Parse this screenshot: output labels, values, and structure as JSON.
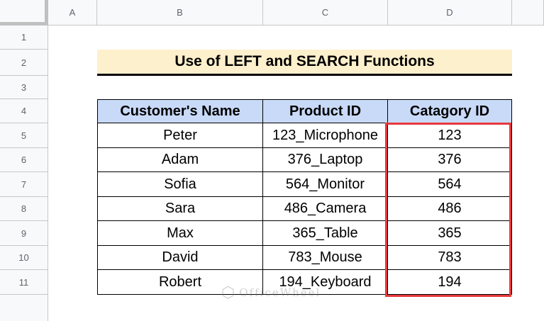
{
  "columns": [
    "A",
    "B",
    "C",
    "D"
  ],
  "rows": [
    "1",
    "2",
    "3",
    "4",
    "5",
    "6",
    "7",
    "8",
    "9",
    "10",
    "11"
  ],
  "title": "Use of LEFT and SEARCH Functions",
  "table": {
    "headers": [
      "Customer's Name",
      "Product ID",
      "Catagory ID"
    ],
    "rows": [
      [
        "Peter",
        "123_Microphone",
        "123"
      ],
      [
        "Adam",
        "376_Laptop",
        "376"
      ],
      [
        "Sofia",
        "564_Monitor",
        "564"
      ],
      [
        "Sara",
        "486_Camera",
        "486"
      ],
      [
        "Max",
        "365_Table",
        "365"
      ],
      [
        "David",
        "783_Mouse",
        "783"
      ],
      [
        "Robert",
        "194_Keyboard",
        "194"
      ]
    ]
  },
  "watermark": "OfficeWheel",
  "colors": {
    "title_bg": "#fdf0cc",
    "header_bg": "#c9daf8",
    "highlight": "#e8383d"
  }
}
